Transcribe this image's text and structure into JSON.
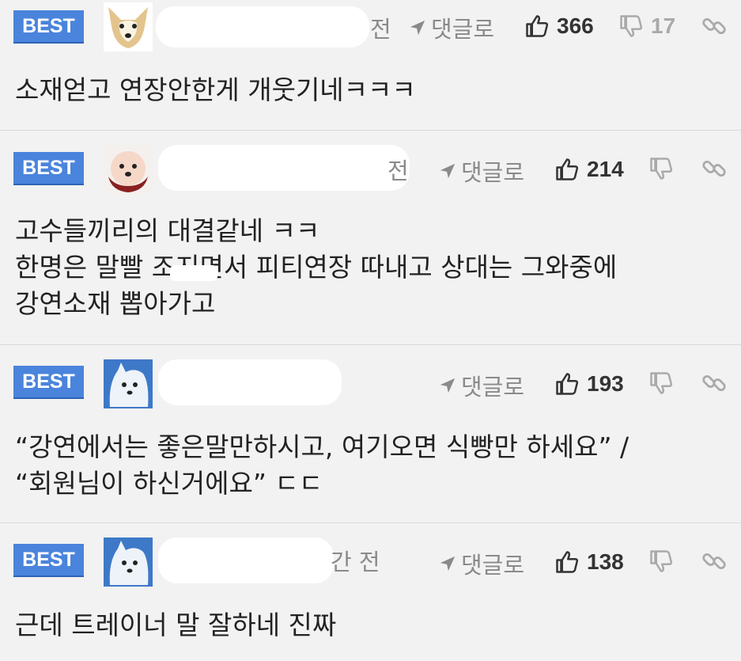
{
  "comments": [
    {
      "badge": "BEST",
      "time": "전",
      "reply_label": "댓글로",
      "likes": "366",
      "dislikes": "17",
      "text": "소재얻고 연장안한게 개웃기네ㅋㅋㅋ"
    },
    {
      "badge": "BEST",
      "time": "전",
      "reply_label": "댓글로",
      "likes": "214",
      "dislikes": "",
      "text": "고수들끼리의 대결같네 ㅋㅋ\n한명은 말빨 조지면서 피티연장 따내고 상대는 그와중에\n강연소재 뽑아가고"
    },
    {
      "badge": "BEST",
      "time": "",
      "reply_label": "댓글로",
      "likes": "193",
      "dislikes": "",
      "text": "“강연에서는 좋은말만하시고, 여기오면 식빵만 하세요” /\n“회원님이 하신거에요” ㄷㄷ"
    },
    {
      "badge": "BEST",
      "time": "간 전",
      "reply_label": "댓글로",
      "likes": "138",
      "dislikes": "",
      "text": "근데 트레이너 말 잘하네 진짜"
    }
  ],
  "colors": {
    "badge": "#4a84dc",
    "background": "#f2f2f2",
    "muted": "#8a8a8a"
  }
}
